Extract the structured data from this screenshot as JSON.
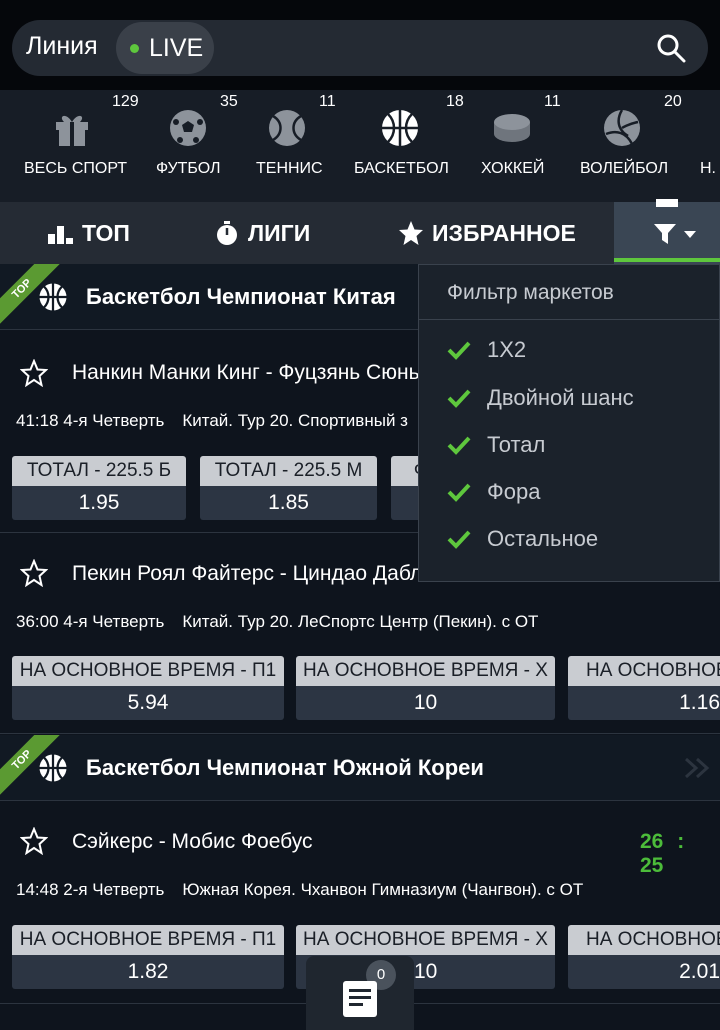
{
  "header": {
    "mode_line": "Линия",
    "mode_live": "LIVE"
  },
  "sports": [
    {
      "label": "ВЕСЬ СПОРТ",
      "count": "129",
      "icon": "gift-icon"
    },
    {
      "label": "ФУТБОЛ",
      "count": "35",
      "icon": "soccer-ball-icon"
    },
    {
      "label": "ТЕННИС",
      "count": "11",
      "icon": "tennis-ball-icon"
    },
    {
      "label": "БАСКЕТБОЛ",
      "count": "18",
      "icon": "basketball-icon"
    },
    {
      "label": "ХОККЕЙ",
      "count": "11",
      "icon": "hockey-puck-icon"
    },
    {
      "label": "ВОЛЕЙБОЛ",
      "count": "20",
      "icon": "volleyball-icon"
    },
    {
      "label": "Н.",
      "count": "",
      "icon": ""
    }
  ],
  "tabs": {
    "top": "ТОП",
    "leagues": "ЛИГИ",
    "favorites": "ИЗБРАННОЕ"
  },
  "leagues": [
    {
      "title": "Баскетбол Чемпионат Китая",
      "badge": "TOP"
    },
    {
      "title": "Баскетбол Чемпионат Южной Кореи",
      "badge": "TOP"
    }
  ],
  "matches": [
    {
      "teams": "Нанкин Манки Кинг - Фуцзянь Сюнь",
      "time": "41:18 4-я Четверть",
      "location": "Китай. Тур 20. Спортивный з",
      "odds": [
        {
          "name": "ТОТАЛ - 225.5 Б",
          "value": "1.95"
        },
        {
          "name": "ТОТАЛ - 225.5 М",
          "value": "1.85"
        },
        {
          "name": "Ф",
          "value": ""
        }
      ]
    },
    {
      "teams": "Пекин Роял Файтерс - Циндао Дабл",
      "time": "36:00 4-я Четверть",
      "location": "Китай. Тур 20. ЛеСпортс Центр (Пекин). с ОТ",
      "odds": [
        {
          "name": "НА ОСНОВНОЕ ВРЕМЯ - П1",
          "value": "5.94"
        },
        {
          "name": "НА ОСНОВНОЕ ВРЕМЯ - Х",
          "value": "10"
        },
        {
          "name": "НА ОСНОВНОЕ",
          "value": "1.16"
        }
      ]
    },
    {
      "teams": "Сэйкерс - Мобис Фоебус",
      "time": "14:48 2-я Четверть",
      "location": "Южная Корея. Чханвон Гимназиум (Чангвон). с ОТ",
      "score_home": "26",
      "score_sep": ":",
      "score_away": "25",
      "odds": [
        {
          "name": "НА ОСНОВНОЕ ВРЕМЯ - П1",
          "value": "1.82"
        },
        {
          "name": "НА ОСНОВНОЕ ВРЕМЯ - Х",
          "value": "10"
        },
        {
          "name": "НА ОСНОВНОЕ",
          "value": "2.01"
        }
      ]
    }
  ],
  "filter": {
    "title": "Фильтр маркетов",
    "items": [
      "1X2",
      "Двойной шанс",
      "Тотал",
      "Фора",
      "Остальное"
    ]
  },
  "bet_slip": {
    "count": "0"
  },
  "colors": {
    "accent": "#5ec73d",
    "score": "#4cbc3a",
    "background": "#0e141d"
  }
}
